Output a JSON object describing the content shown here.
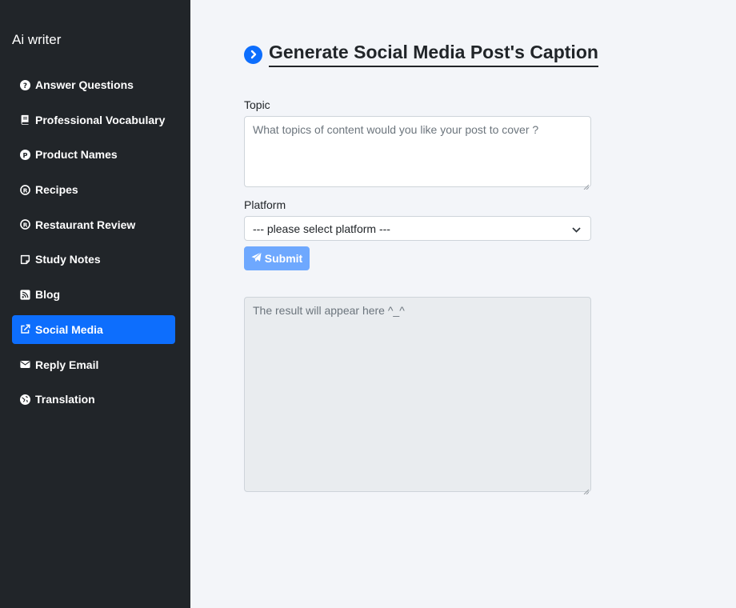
{
  "sidebar": {
    "brand": "Ai writer",
    "items": [
      {
        "label": "Answer Questions",
        "icon": "question-circle-icon"
      },
      {
        "label": "Professional Vocabulary",
        "icon": "book-icon"
      },
      {
        "label": "Product Names",
        "icon": "p-circle-icon"
      },
      {
        "label": "Recipes",
        "icon": "registered-icon"
      },
      {
        "label": "Restaurant Review",
        "icon": "registered-icon"
      },
      {
        "label": "Study Notes",
        "icon": "sticky-note-icon"
      },
      {
        "label": "Blog",
        "icon": "rss-icon"
      },
      {
        "label": "Social Media",
        "icon": "share-square-icon",
        "active": true
      },
      {
        "label": "Reply Email",
        "icon": "envelope-icon"
      },
      {
        "label": "Translation",
        "icon": "globe-icon"
      }
    ]
  },
  "main": {
    "title": "Generate Social Media Post's Caption",
    "title_icon": "chevron-circle-right-icon",
    "topic_label": "Topic",
    "topic_placeholder": "What topics of content would you like your post to cover ?",
    "platform_label": "Platform",
    "platform_selected": "--- please select platform ---",
    "submit_label": "Submit",
    "result_placeholder": "The result will appear here ^_^"
  },
  "colors": {
    "sidebar_bg": "#212529",
    "accent": "#0d6efd",
    "submit_bg": "#6ea8fe",
    "page_bg": "#f3f5f9",
    "result_bg": "#e9ecef"
  }
}
